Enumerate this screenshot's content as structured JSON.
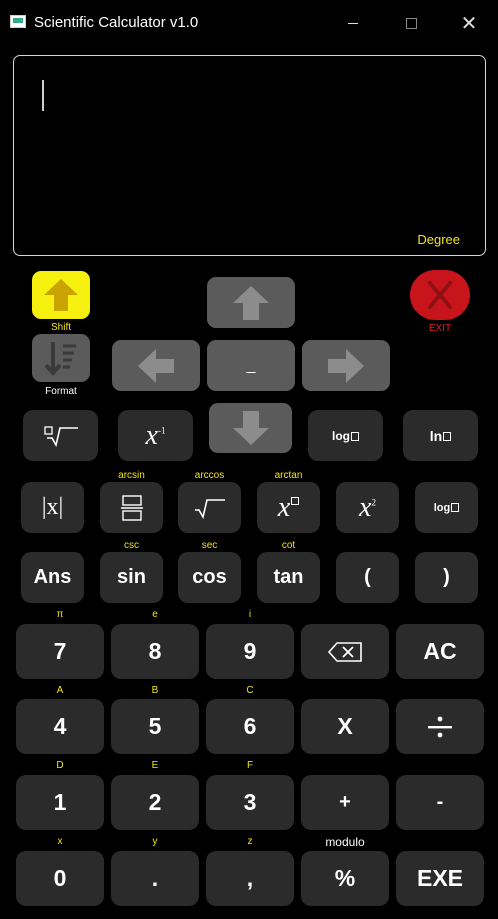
{
  "window": {
    "title": "Scientific Calculator v1.0",
    "close_glyph": "✕"
  },
  "display": {
    "angle_mode": "Degree"
  },
  "top": {
    "shift_label": "Shift",
    "exit_label": "EXIT",
    "format_label": "Format",
    "center_key": "_",
    "shift_color": "#f5f00d",
    "exit_color": "#c8151b"
  },
  "row1": {
    "log_label": "log",
    "ln_label": "ln"
  },
  "row2": {
    "arcsin": "arcsin",
    "arccos": "arccos",
    "arctan": "arctan",
    "abs_label": "|x|",
    "log_label": "log"
  },
  "row3": {
    "csc": "csc",
    "sec": "sec",
    "cot": "cot",
    "ans": "Ans",
    "sin": "sin",
    "cos": "cos",
    "tan": "tan",
    "lparen": "(",
    "rparen": ")"
  },
  "row4": {
    "pi": "π",
    "e": "e",
    "i": "i",
    "seven": "7",
    "eight": "8",
    "nine": "9",
    "ac": "AC"
  },
  "row5": {
    "A": "A",
    "B": "B",
    "C": "C",
    "four": "4",
    "five": "5",
    "six": "6",
    "multiply": "X"
  },
  "row6": {
    "D": "D",
    "E": "E",
    "F": "F",
    "one": "1",
    "two": "2",
    "three": "3",
    "plus": "+",
    "minus": "-"
  },
  "row7": {
    "x": "x",
    "y": "y",
    "z": "z",
    "modulo": "modulo",
    "zero": "0",
    "dot": ".",
    "comma": ",",
    "percent": "%",
    "exe": "EXE"
  }
}
